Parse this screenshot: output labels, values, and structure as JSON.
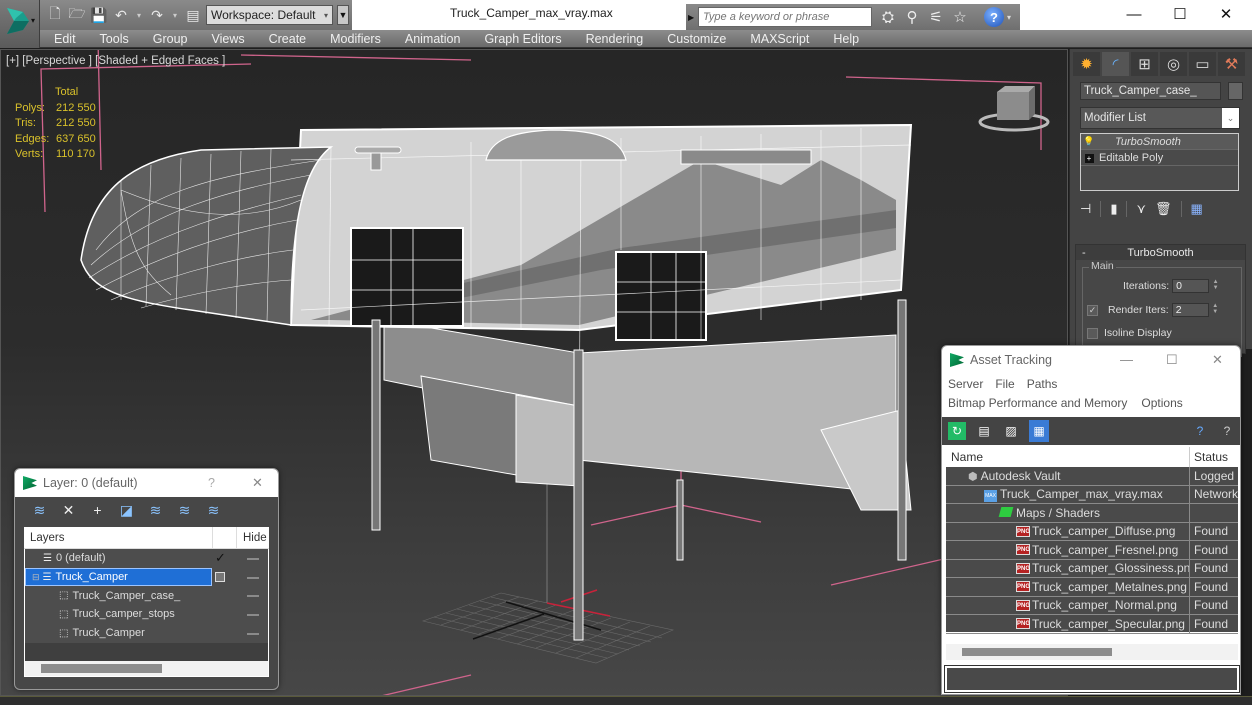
{
  "app": {
    "title": "Truck_Camper_max_vray.max",
    "workspace": "Workspace: Default",
    "search_placeholder": "Type a keyword or phrase",
    "help_label": "?",
    "window_controls": {
      "minimize": "—",
      "maximize": "☐",
      "close": "✕"
    }
  },
  "menu": [
    "Edit",
    "Tools",
    "Group",
    "Views",
    "Create",
    "Modifiers",
    "Animation",
    "Graph Editors",
    "Rendering",
    "Customize",
    "MAXScript",
    "Help"
  ],
  "viewport": {
    "label": "[+] [Perspective ] [Shaded + Edged Faces ]",
    "stats": {
      "header": "Total",
      "rows": [
        {
          "key": "Polys:",
          "value": "212 550"
        },
        {
          "key": "Tris:",
          "value": "212 550"
        },
        {
          "key": "Edges:",
          "value": "637 650"
        },
        {
          "key": "Verts:",
          "value": "110 170"
        }
      ]
    },
    "colors": {
      "stats": "#d9c12b",
      "selection_bracket": "#d0648c",
      "wire": "#ffffff"
    }
  },
  "command_panel": {
    "tabs": [
      "create-icon",
      "modify-icon",
      "hierarchy-icon",
      "motion-icon",
      "display-icon",
      "utilities-icon"
    ],
    "object_name": "Truck_Camper_case_",
    "modifier_list": "Modifier List",
    "stack": [
      {
        "label": "TurboSmooth",
        "icon": "lightbulb-icon",
        "selected": true
      },
      {
        "label": "Editable Poly",
        "icon": "expand-plus-icon",
        "selected": false
      }
    ],
    "rollout": {
      "title": "TurboSmooth",
      "collapse": "-",
      "group": "Main",
      "iterations_label": "Iterations:",
      "iterations": "0",
      "render_iters_label": "Render Iters:",
      "render_iters": "2",
      "render_iters_checked": true,
      "isoline_label": "Isoline Display",
      "isoline_checked": false
    }
  },
  "asset_tracking": {
    "title": "Asset Tracking",
    "menu_row1": [
      "Server",
      "File",
      "Paths"
    ],
    "menu_row2": [
      "Bitmap Performance and Memory",
      "Options"
    ],
    "columns": [
      "Name",
      "Status"
    ],
    "rows": [
      {
        "name": "Autodesk Vault",
        "status": "Logged",
        "indent": 1,
        "icon": "vault-icon"
      },
      {
        "name": "Truck_Camper_max_vray.max",
        "status": "Network",
        "indent": 2,
        "icon": "max-file-icon"
      },
      {
        "name": "Maps / Shaders",
        "status": "",
        "indent": 3,
        "icon": "maps-icon"
      },
      {
        "name": "Truck_camper_Diffuse.png",
        "status": "Found",
        "indent": 4,
        "icon": "png-icon"
      },
      {
        "name": "Truck_camper_Fresnel.png",
        "status": "Found",
        "indent": 4,
        "icon": "png-icon"
      },
      {
        "name": "Truck_camper_Glossiness.png",
        "status": "Found",
        "indent": 4,
        "icon": "png-icon"
      },
      {
        "name": "Truck_camper_Metalnes.png",
        "status": "Found",
        "indent": 4,
        "icon": "png-icon"
      },
      {
        "name": "Truck_camper_Normal.png",
        "status": "Found",
        "indent": 4,
        "icon": "png-icon"
      },
      {
        "name": "Truck_camper_Specular.png",
        "status": "Found",
        "indent": 4,
        "icon": "png-icon"
      }
    ],
    "png_badge": "PNG"
  },
  "layer_window": {
    "title": "Layer: 0 (default)",
    "help": "?",
    "close": "✕",
    "columns": [
      "Layers",
      "Hide"
    ],
    "rows": [
      {
        "name": "0 (default)",
        "type": "layer",
        "indent": 1,
        "current": true,
        "selected": false
      },
      {
        "name": "Truck_Camper",
        "type": "layer",
        "indent": 1,
        "current": false,
        "selected": true
      },
      {
        "name": "Truck_Camper_case_",
        "type": "object",
        "indent": 2,
        "current": false,
        "selected": false
      },
      {
        "name": "Truck_camper_stops",
        "type": "object",
        "indent": 2,
        "current": false,
        "selected": false
      },
      {
        "name": "Truck_Camper",
        "type": "object",
        "indent": 2,
        "current": false,
        "selected": false
      }
    ]
  }
}
